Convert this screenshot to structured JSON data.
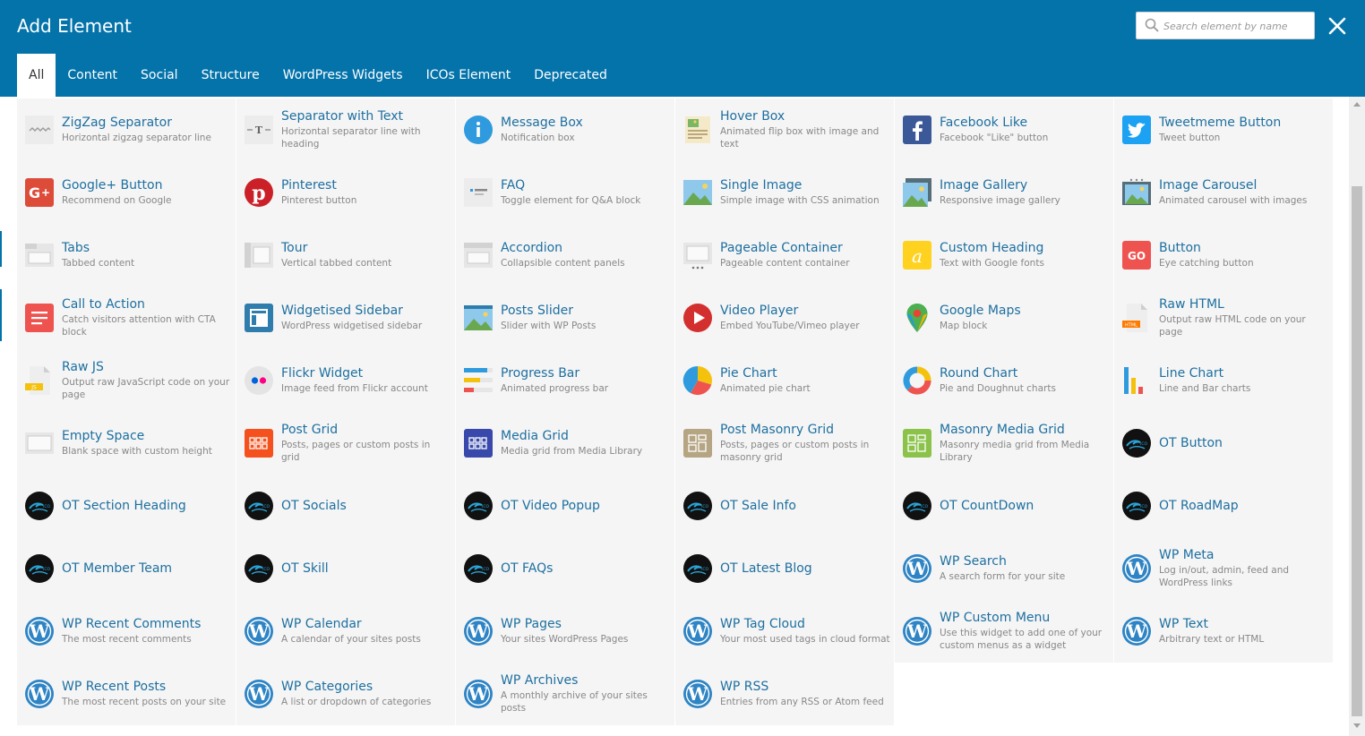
{
  "title": "Add Element",
  "search": {
    "placeholder": "Search element by name"
  },
  "tabs": [
    {
      "label": "All"
    },
    {
      "label": "Content"
    },
    {
      "label": "Social"
    },
    {
      "label": "Structure"
    },
    {
      "label": "WordPress Widgets"
    },
    {
      "label": "ICOs Element"
    },
    {
      "label": "Deprecated"
    }
  ],
  "colors": {
    "header": "#0473aa",
    "card_bg": "#f5f5f5",
    "name_link": "#1d6fa0"
  },
  "elements": [
    {
      "name": "ZigZag Separator",
      "desc": "Horizontal zigzag separator line",
      "icon": "zigzag-icon"
    },
    {
      "name": "Separator with Text",
      "desc": "Horizontal separator line with heading",
      "icon": "separator-text-icon"
    },
    {
      "name": "Message Box",
      "desc": "Notification box",
      "icon": "info-icon"
    },
    {
      "name": "Hover Box",
      "desc": "Animated flip box with image and text",
      "icon": "hover-box-icon"
    },
    {
      "name": "Facebook Like",
      "desc": "Facebook \"Like\" button",
      "icon": "facebook-icon"
    },
    {
      "name": "Tweetmeme Button",
      "desc": "Tweet button",
      "icon": "twitter-icon"
    },
    {
      "name": "Google+ Button",
      "desc": "Recommend on Google",
      "icon": "google-plus-icon"
    },
    {
      "name": "Pinterest",
      "desc": "Pinterest button",
      "icon": "pinterest-icon"
    },
    {
      "name": "FAQ",
      "desc": "Toggle element for Q&A block",
      "icon": "faq-icon"
    },
    {
      "name": "Single Image",
      "desc": "Simple image with CSS animation",
      "icon": "image-icon"
    },
    {
      "name": "Image Gallery",
      "desc": "Responsive image gallery",
      "icon": "gallery-icon"
    },
    {
      "name": "Image Carousel",
      "desc": "Animated carousel with images",
      "icon": "carousel-icon"
    },
    {
      "name": "Tabs",
      "desc": "Tabbed content",
      "icon": "tabs-icon"
    },
    {
      "name": "Tour",
      "desc": "Vertical tabbed content",
      "icon": "tour-icon"
    },
    {
      "name": "Accordion",
      "desc": "Collapsible content panels",
      "icon": "accordion-icon"
    },
    {
      "name": "Pageable Container",
      "desc": "Pageable content container",
      "icon": "pageable-icon"
    },
    {
      "name": "Custom Heading",
      "desc": "Text with Google fonts",
      "icon": "custom-heading-icon"
    },
    {
      "name": "Button",
      "desc": "Eye catching button",
      "icon": "button-go-icon"
    },
    {
      "name": "Call to Action",
      "desc": "Catch visitors attention with CTA block",
      "icon": "cta-icon"
    },
    {
      "name": "Widgetised Sidebar",
      "desc": "WordPress widgetised sidebar",
      "icon": "sidebar-icon"
    },
    {
      "name": "Posts Slider",
      "desc": "Slider with WP Posts",
      "icon": "posts-slider-icon"
    },
    {
      "name": "Video Player",
      "desc": "Embed YouTube/Vimeo player",
      "icon": "play-icon"
    },
    {
      "name": "Google Maps",
      "desc": "Map block",
      "icon": "map-icon"
    },
    {
      "name": "Raw HTML",
      "desc": "Output raw HTML code on your page",
      "icon": "raw-html-icon"
    },
    {
      "name": "Raw JS",
      "desc": "Output raw JavaScript code on your page",
      "icon": "raw-js-icon"
    },
    {
      "name": "Flickr Widget",
      "desc": "Image feed from Flickr account",
      "icon": "flickr-icon"
    },
    {
      "name": "Progress Bar",
      "desc": "Animated progress bar",
      "icon": "progress-bar-icon"
    },
    {
      "name": "Pie Chart",
      "desc": "Animated pie chart",
      "icon": "pie-chart-icon"
    },
    {
      "name": "Round Chart",
      "desc": "Pie and Doughnut charts",
      "icon": "round-chart-icon"
    },
    {
      "name": "Line Chart",
      "desc": "Line and Bar charts",
      "icon": "line-chart-icon"
    },
    {
      "name": "Empty Space",
      "desc": "Blank space with custom height",
      "icon": "empty-space-icon"
    },
    {
      "name": "Post Grid",
      "desc": "Posts, pages or custom posts in grid",
      "icon": "post-grid-icon"
    },
    {
      "name": "Media Grid",
      "desc": "Media grid from Media Library",
      "icon": "media-grid-icon"
    },
    {
      "name": "Post Masonry Grid",
      "desc": "Posts, pages or custom posts in masonry grid",
      "icon": "masonry-grid-icon"
    },
    {
      "name": "Masonry Media Grid",
      "desc": "Masonry media grid from Media Library",
      "icon": "masonry-media-icon"
    },
    {
      "name": "OT Button",
      "desc": "",
      "icon": "ot-logo-icon"
    },
    {
      "name": "OT Section Heading",
      "desc": "",
      "icon": "ot-logo-icon"
    },
    {
      "name": "OT Socials",
      "desc": "",
      "icon": "ot-logo-icon"
    },
    {
      "name": "OT Video Popup",
      "desc": "",
      "icon": "ot-logo-icon"
    },
    {
      "name": "OT Sale Info",
      "desc": "",
      "icon": "ot-logo-icon"
    },
    {
      "name": "OT CountDown",
      "desc": "",
      "icon": "ot-logo-icon"
    },
    {
      "name": "OT RoadMap",
      "desc": "",
      "icon": "ot-logo-icon"
    },
    {
      "name": "OT Member Team",
      "desc": "",
      "icon": "ot-logo-icon"
    },
    {
      "name": "OT Skill",
      "desc": "",
      "icon": "ot-logo-icon"
    },
    {
      "name": "OT FAQs",
      "desc": "",
      "icon": "ot-logo-icon"
    },
    {
      "name": "OT Latest Blog",
      "desc": "",
      "icon": "ot-logo-icon"
    },
    {
      "name": "WP Search",
      "desc": "A search form for your site",
      "icon": "wordpress-icon"
    },
    {
      "name": "WP Meta",
      "desc": "Log in/out, admin, feed and WordPress links",
      "icon": "wordpress-icon"
    },
    {
      "name": "WP Recent Comments",
      "desc": "The most recent comments",
      "icon": "wordpress-icon"
    },
    {
      "name": "WP Calendar",
      "desc": "A calendar of your sites posts",
      "icon": "wordpress-icon"
    },
    {
      "name": "WP Pages",
      "desc": "Your sites WordPress Pages",
      "icon": "wordpress-icon"
    },
    {
      "name": "WP Tag Cloud",
      "desc": "Your most used tags in cloud format",
      "icon": "wordpress-icon"
    },
    {
      "name": "WP Custom Menu",
      "desc": "Use this widget to add one of your custom menus as a widget",
      "icon": "wordpress-icon"
    },
    {
      "name": "WP Text",
      "desc": "Arbitrary text or HTML",
      "icon": "wordpress-icon"
    },
    {
      "name": "WP Recent Posts",
      "desc": "The most recent posts on your site",
      "icon": "wordpress-icon"
    },
    {
      "name": "WP Categories",
      "desc": "A list or dropdown of categories",
      "icon": "wordpress-icon"
    },
    {
      "name": "WP Archives",
      "desc": "A monthly archive of your sites posts",
      "icon": "wordpress-icon"
    },
    {
      "name": "WP RSS",
      "desc": "Entries from any RSS or Atom feed",
      "icon": "wordpress-icon"
    }
  ]
}
